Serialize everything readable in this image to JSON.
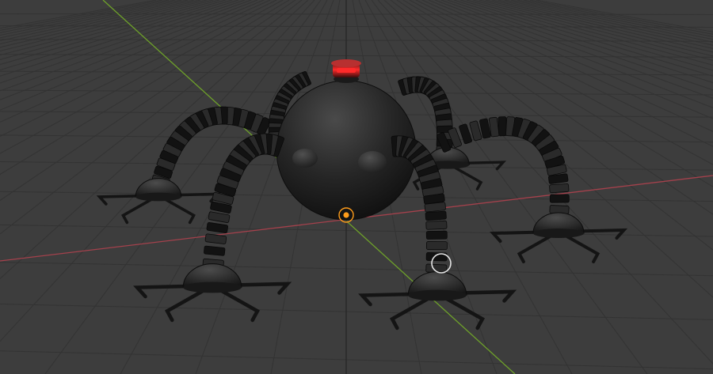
{
  "viewport": {
    "background_color": "#3d3d3d",
    "grid_color": "#333333",
    "x_axis_color": "#a4414c",
    "y_axis_color": "#6ea12a",
    "z_axis_color": "#262626"
  },
  "scene": {
    "object": "spider-robot",
    "body_color": "#1c1c1c",
    "eye_light_color": "#ff2a2a",
    "leg_count": 6
  },
  "gizmos": {
    "origin_marker_color": "#ff9c1a",
    "cursor_ring_color": "#e6e6e6",
    "object_origin_icon": "object-origin-icon",
    "cursor_icon": "3d-cursor-icon"
  }
}
